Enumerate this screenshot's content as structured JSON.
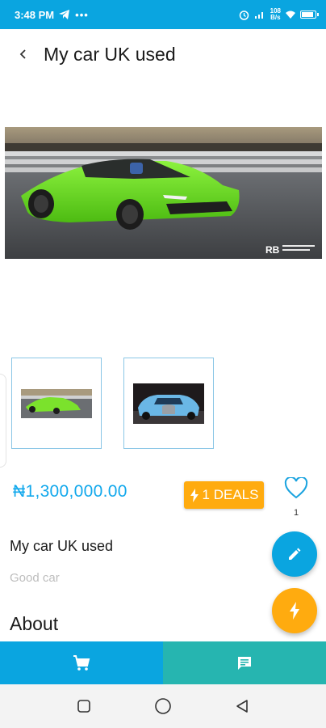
{
  "status_bar": {
    "time": "3:48 PM",
    "dots": "•••",
    "speed_top": "108",
    "speed_bottom": "B/s",
    "icons": [
      "telegram-icon",
      "alarm-icon",
      "signal-icon",
      "wifi-icon",
      "battery-icon"
    ],
    "battery_level": 0.8
  },
  "app_bar": {
    "title": "My car UK used"
  },
  "product": {
    "price": "₦1,300,000.00",
    "deals_label": "1 DEALS",
    "favorite_count": "1",
    "title": "My car UK used",
    "description": "Good car",
    "about_heading": "About",
    "watermark": "RB"
  },
  "thumbnails": [
    {
      "name": "green-sports-car"
    },
    {
      "name": "blue-sports-car"
    }
  ],
  "colors": {
    "primary": "#0aa5e0",
    "price": "#11a8ec",
    "accent": "#ffab0f",
    "chat_tab": "#26b5b0"
  }
}
